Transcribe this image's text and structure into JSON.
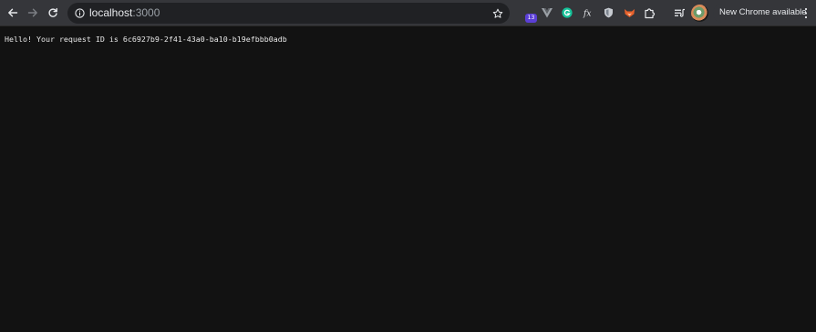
{
  "browser": {
    "url_host": "localhost",
    "url_port": ":3000",
    "update_label": "New Chrome available",
    "extension_badge": "13",
    "icons": {
      "back": "arrow-left-icon",
      "forward": "arrow-right-icon",
      "reload": "reload-icon",
      "site_info": "info-icon",
      "bookmark": "star-icon",
      "extensions": "puzzle-icon",
      "reading_list": "reading-list-icon",
      "menu": "kebab-menu-icon"
    },
    "colors": {
      "toolbar": "#35363a",
      "omnibox": "#202124",
      "page_background": "#121212",
      "text": "#e8e8e8"
    }
  },
  "page": {
    "message": "Hello! Your request ID is 6c6927b9-2f41-43a0-ba10-b19efbbb0adb"
  }
}
